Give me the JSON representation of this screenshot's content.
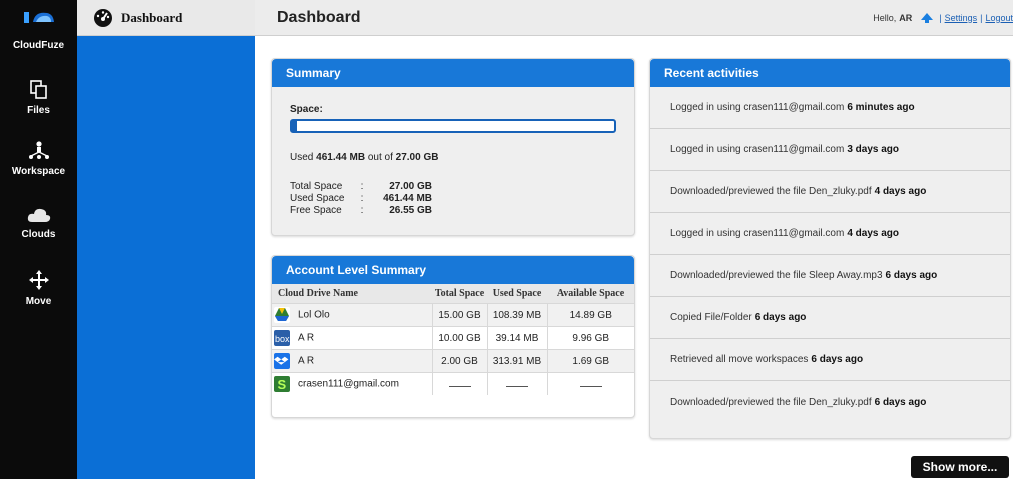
{
  "rail": {
    "brand": "CloudFuze",
    "items": [
      {
        "label": "Files",
        "icon": "files-icon"
      },
      {
        "label": "Workspace",
        "icon": "workspace-icon"
      },
      {
        "label": "Clouds",
        "icon": "cloud-icon"
      },
      {
        "label": "Move",
        "icon": "move-icon"
      }
    ]
  },
  "subbar": {
    "label": "Dashboard",
    "icon": "speedometer-icon"
  },
  "header": {
    "title": "Dashboard",
    "greeting": "Hello,",
    "user": "AR",
    "settings": "Settings",
    "separator": "|",
    "logout": "Logout"
  },
  "summary": {
    "title": "Summary",
    "space_label": "Space:",
    "used_fraction": 0.017,
    "used_prefix": "Used",
    "used_value": "461.44 MB",
    "out_of": "out of",
    "total_value": "27.00 GB",
    "rows": [
      {
        "k": "Total Space",
        "c": ":",
        "v": "27.00 GB"
      },
      {
        "k": "Used Space",
        "c": ":",
        "v": "461.44 MB"
      },
      {
        "k": "Free Space",
        "c": ":",
        "v": "26.55 GB"
      }
    ]
  },
  "account": {
    "title": "Account Level Summary",
    "headers": {
      "name": "Cloud Drive Name",
      "total": "Total Space",
      "used": "Used Space",
      "available": "Available Space"
    },
    "rows": [
      {
        "name": "Lol Olo",
        "total": "15.00 GB",
        "used": "108.39 MB",
        "available": "14.89 GB",
        "icon": "google-drive-icon"
      },
      {
        "name": "A R",
        "total": "10.00 GB",
        "used": "39.14 MB",
        "available": "9.96 GB",
        "icon": "box-icon"
      },
      {
        "name": "A R",
        "total": "2.00 GB",
        "used": "313.91 MB",
        "available": "1.69 GB",
        "icon": "dropbox-icon"
      },
      {
        "name": "crasen111@gmail.com",
        "total": "",
        "used": "",
        "available": "",
        "icon": "sugarsync-icon"
      }
    ]
  },
  "recent": {
    "title": "Recent activities",
    "items": [
      {
        "text": "Logged in using crasen111@gmail.com",
        "when": "6 minutes ago"
      },
      {
        "text": "Logged in using crasen111@gmail.com",
        "when": "3 days ago"
      },
      {
        "text": "Downloaded/previewed the file Den_zluky.pdf",
        "when": "4 days ago"
      },
      {
        "text": "Logged in using crasen111@gmail.com",
        "when": "4 days ago"
      },
      {
        "text": "Downloaded/previewed the file Sleep Away.mp3",
        "when": "6 days ago"
      },
      {
        "text": "Copied File/Folder",
        "when": "6 days ago"
      },
      {
        "text": "Retrieved all move workspaces",
        "when": "6 days ago"
      },
      {
        "text": "Downloaded/previewed the file Den_zluky.pdf",
        "when": "6 days ago"
      }
    ],
    "show_more": "Show more..."
  },
  "colors": {
    "accent": "#1878d8",
    "sidebar": "#0b6fd6",
    "rail": "#0b0b0b"
  }
}
